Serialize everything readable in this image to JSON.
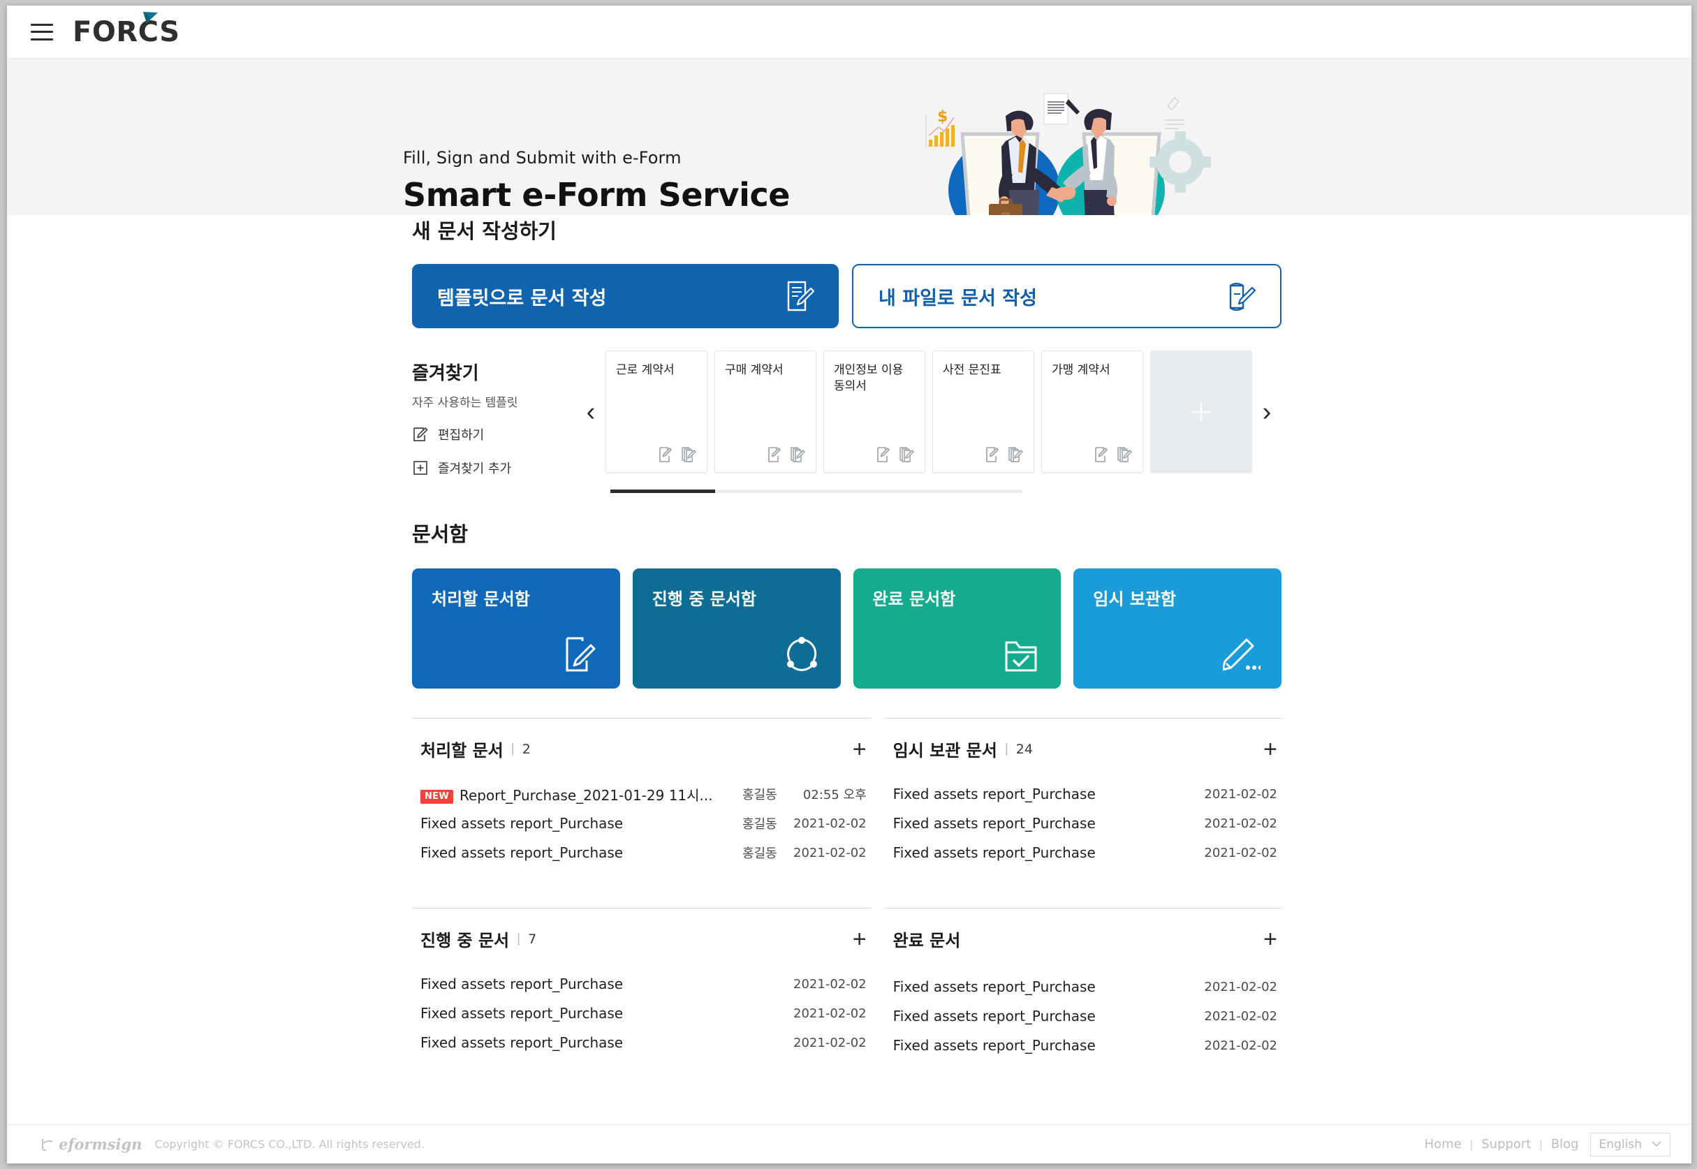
{
  "header": {
    "menu_icon": "hamburger-menu-icon",
    "brand": "FORCS"
  },
  "hero": {
    "subtitle": "Fill, Sign and Submit with e-Form",
    "title": "Smart e-Form Service",
    "illustration": "handshake-esign-illustration"
  },
  "create_section": {
    "title": "새 문서 작성하기",
    "buttons": [
      {
        "label": "템플릿으로 문서 작성",
        "icon": "document-edit-icon"
      },
      {
        "label": "내 파일로 문서 작성",
        "icon": "file-upload-edit-icon"
      }
    ]
  },
  "favorites": {
    "title": "즐겨찾기",
    "subtitle": "자주 사용하는 템플릿",
    "actions": [
      {
        "label": "편집하기",
        "icon": "edit-icon"
      },
      {
        "label": "즐겨찾기 추가",
        "icon": "plus-box-icon"
      }
    ],
    "prev_icon": "chevron-left-icon",
    "next_icon": "chevron-right-icon",
    "add_card_icon": "plus-icon",
    "cards": [
      {
        "name": "근로 계약서"
      },
      {
        "name": "구매 계약서"
      },
      {
        "name": "개인정보 이용 동의서"
      },
      {
        "name": "사전 문진표"
      },
      {
        "name": "가맹 계약서"
      }
    ]
  },
  "doc_boxes": {
    "title": "문서함",
    "items": [
      {
        "label": "처리할 문서함",
        "color": "#1069b8",
        "icon": "document-pen-icon"
      },
      {
        "label": "진행 중 문서함",
        "color": "#0d6d94",
        "icon": "progress-circle-icon"
      },
      {
        "label": "완료 문서함",
        "color": "#15ab8e",
        "icon": "folder-check-icon"
      },
      {
        "label": "임시 보관함",
        "color": "#1a9cd8",
        "icon": "pencil-dots-icon"
      }
    ]
  },
  "lists": {
    "plus_icon": "plus-icon",
    "panels": [
      {
        "title": "처리할 문서",
        "count": "2",
        "has_count": true,
        "rows": [
          {
            "badge": "NEW",
            "name": "Report_Purchase_2021-01-29 11시...",
            "who": "홍길동",
            "date": "02:55 오후"
          },
          {
            "badge": "",
            "name": "Fixed assets report_Purchase",
            "who": "홍길동",
            "date": "2021-02-02"
          },
          {
            "badge": "",
            "name": "Fixed assets report_Purchase",
            "who": "홍길동",
            "date": "2021-02-02"
          }
        ]
      },
      {
        "title": "임시 보관 문서",
        "count": "24",
        "has_count": true,
        "rows": [
          {
            "badge": "",
            "name": "Fixed assets report_Purchase",
            "who": "",
            "date": "2021-02-02"
          },
          {
            "badge": "",
            "name": "Fixed assets report_Purchase",
            "who": "",
            "date": "2021-02-02"
          },
          {
            "badge": "",
            "name": "Fixed assets report_Purchase",
            "who": "",
            "date": "2021-02-02"
          }
        ]
      },
      {
        "title": "진행 중 문서",
        "count": "7",
        "has_count": true,
        "rows": [
          {
            "badge": "",
            "name": "Fixed assets report_Purchase",
            "who": "",
            "date": "2021-02-02"
          },
          {
            "badge": "",
            "name": "Fixed assets report_Purchase",
            "who": "",
            "date": "2021-02-02"
          },
          {
            "badge": "",
            "name": "Fixed assets report_Purchase",
            "who": "",
            "date": "2021-02-02"
          }
        ]
      },
      {
        "title": "완료 문서",
        "count": "",
        "has_count": false,
        "rows": [
          {
            "badge": "",
            "name": "Fixed assets report_Purchase",
            "who": "",
            "date": "2021-02-02"
          },
          {
            "badge": "",
            "name": "Fixed assets report_Purchase",
            "who": "",
            "date": "2021-02-02"
          },
          {
            "badge": "",
            "name": "Fixed assets report_Purchase",
            "who": "",
            "date": "2021-02-02"
          }
        ]
      }
    ]
  },
  "footer": {
    "logo_text": "eformsign",
    "copyright": "Copyright © FORCS CO.,LTD. All rights reserved.",
    "links": [
      "Home",
      "Support",
      "Blog"
    ],
    "divider": "|",
    "language": "English",
    "language_caret": "chevron-down-icon"
  },
  "colors": {
    "primary": "#1064ad",
    "badge_new": "#f0433d",
    "hero_bg": "#f4f4f4"
  }
}
